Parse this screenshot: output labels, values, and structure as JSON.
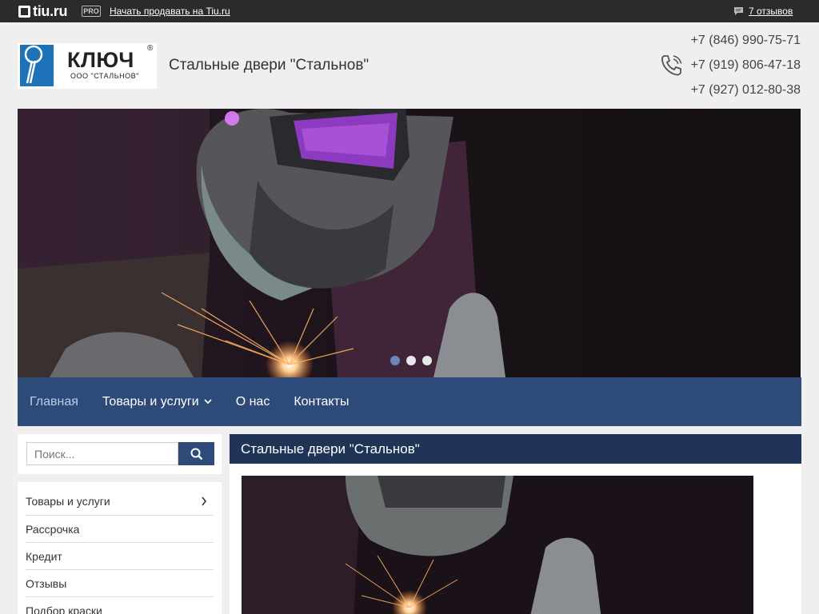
{
  "topbar": {
    "logo_text": "tiu.ru",
    "pro_badge": "PRO",
    "sell_link": "Начать продавать на Tiu.ru",
    "reviews_link": "7 отзывов"
  },
  "header": {
    "logo_brand": "КЛЮЧ",
    "logo_company": "ООО \"СТАЛЬНОВ\"",
    "site_title": "Стальные двери \"Стальнов\"",
    "phones": [
      "+7 (846) 990-75-71",
      "+7 (919) 806-47-18",
      "+7 (927) 012-80-38"
    ]
  },
  "banner": {
    "slides_count": 3,
    "active_slide": 1
  },
  "nav": {
    "items": [
      {
        "label": "Главная",
        "active": true
      },
      {
        "label": "Товары и услуги",
        "has_dropdown": true
      },
      {
        "label": "О нас"
      },
      {
        "label": "Контакты"
      }
    ]
  },
  "sidebar": {
    "search_placeholder": "Поиск...",
    "menu": [
      {
        "label": "Товары и услуги",
        "has_arrow": true
      },
      {
        "label": "Рассрочка"
      },
      {
        "label": "Кредит"
      },
      {
        "label": "Отзывы"
      },
      {
        "label": "Подбор краски"
      }
    ]
  },
  "main": {
    "title": "Стальные двери \"Стальнов\""
  },
  "colors": {
    "topbar": "#2b2b2b",
    "nav": "#2d4a79",
    "main_header": "#1f3457",
    "page_bg": "#efefef"
  }
}
